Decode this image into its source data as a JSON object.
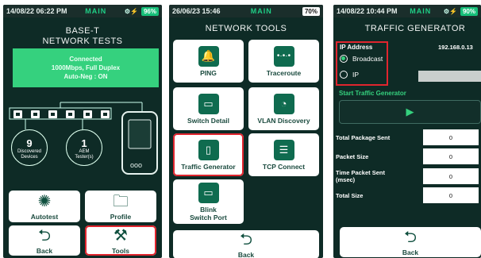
{
  "screen1": {
    "status": {
      "time": "14/08/22 06:22 PM",
      "mode": "MAIN",
      "battery": "96%"
    },
    "title_line1": "BASE-T",
    "title_line2": "NETWORK TESTS",
    "banner": {
      "line1": "Connected",
      "line2": "1000Mbps, Full Duplex",
      "line3": "Auto-Neg : ON"
    },
    "discovered": {
      "count": "9",
      "label_line1": "Discovered",
      "label_line2": "Devices"
    },
    "aem": {
      "count": "1",
      "label_line1": "AEM",
      "label_line2": "Tester(s)"
    },
    "buttons": {
      "autotest": "Autotest",
      "profile": "Profile",
      "back": "Back",
      "tools": "Tools"
    }
  },
  "screen2": {
    "status": {
      "time": "26/06/23 15:46",
      "mode": "MAIN",
      "battery": "70%"
    },
    "title": "NETWORK TOOLS",
    "buttons": {
      "ping": "PING",
      "traceroute": "Traceroute",
      "switch_detail": "Switch Detail",
      "vlan_discovery": "VLAN Discovery",
      "traffic_generator": "Traffic Generator",
      "tcp_connect": "TCP Connect",
      "blink_line1": "Blink",
      "blink_line2": "Switch Port",
      "back": "Back"
    }
  },
  "screen3": {
    "status": {
      "time": "14/08/22 10:44 PM",
      "mode": "MAIN",
      "battery": "90%"
    },
    "title": "TRAFFIC GENERATOR",
    "ip_address_label": "IP Address",
    "ip_value": "192.168.0.13",
    "broadcast_label": "Broadcast",
    "ip_label": "IP",
    "start_label": "Start Traffic Generator",
    "rows": {
      "total_package_sent": {
        "label": "Total Package Sent",
        "value": "0"
      },
      "packet_size": {
        "label": "Packet Size",
        "value": "0"
      },
      "time_packet_sent": {
        "label_line1": "Time Packet Sent",
        "label_line2": "(msec)",
        "value": "0"
      },
      "total_size": {
        "label": "Total Size",
        "value": "0"
      }
    },
    "back": "Back"
  },
  "colors": {
    "accent_green": "#35d17e",
    "highlight_red": "#e0252e",
    "background": "#0e2b26"
  }
}
